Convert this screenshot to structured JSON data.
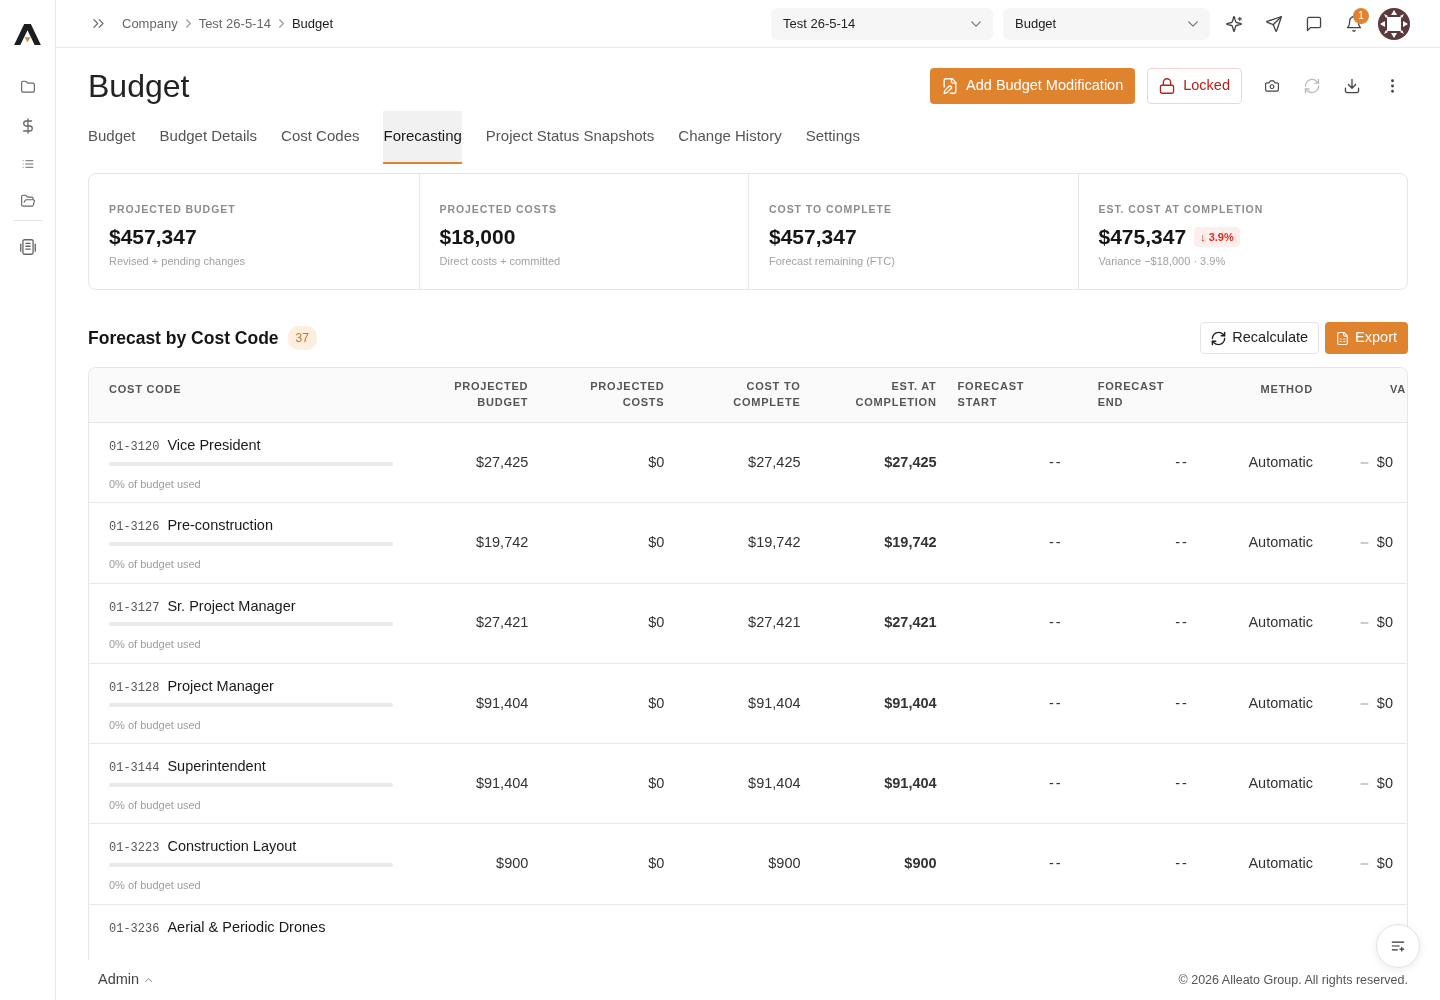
{
  "topbar": {
    "breadcrumbs": [
      {
        "label": "Company",
        "current": false
      },
      {
        "label": "Test 26-5-14",
        "current": false
      },
      {
        "label": "Budget",
        "current": true
      }
    ],
    "project_select": {
      "value": "Test 26-5-14"
    },
    "page_select": {
      "value": "Budget"
    },
    "notifications": {
      "count": "1"
    }
  },
  "page": {
    "title": "Budget",
    "actions": [
      {
        "label": "Add Budget Modification",
        "kind": "primary"
      },
      {
        "label": "Locked",
        "kind": "locked"
      }
    ],
    "toolbar": [
      {
        "disabled": false
      },
      {
        "disabled": true
      },
      {
        "disabled": false
      },
      {
        "disabled": false
      }
    ]
  },
  "tabs": [
    {
      "label": "Budget",
      "selected": false
    },
    {
      "label": "Budget Details",
      "selected": false
    },
    {
      "label": "Cost Codes",
      "selected": false
    },
    {
      "label": "Forecasting",
      "selected": true
    },
    {
      "label": "Project Status Snapshots",
      "selected": false
    },
    {
      "label": "Change History",
      "selected": false
    },
    {
      "label": "Settings",
      "selected": false
    }
  ],
  "summary": [
    {
      "label": "PROJECTED BUDGET",
      "value": "$457,347",
      "note": "Revised + pending changes"
    },
    {
      "label": "PROJECTED COSTS",
      "value": "$18,000",
      "note": "Direct costs + committed"
    },
    {
      "label": "COST TO COMPLETE",
      "value": "$457,347",
      "note": "Forecast remaining (FTC)"
    },
    {
      "label": "EST. COST AT COMPLETION",
      "value": "$475,347",
      "change": {
        "text": "↓ 3.9%",
        "negative": true
      },
      "note": "Variance −$18,000 · 3.9%"
    }
  ],
  "forecast": {
    "title": "Forecast by Cost Code",
    "count": "37",
    "actions": [
      {
        "label": "Recalculate",
        "kind": "secondary"
      },
      {
        "label": "Export",
        "kind": "primary"
      }
    ],
    "table": {
      "columns": [
        "COST CODE",
        "PROJECTED BUDGET",
        "PROJECTED COSTS",
        "COST TO COMPLETE",
        "EST. AT COMPLETION",
        "FORECAST START",
        "FORECAST END",
        "METHOD",
        "VA"
      ],
      "rows": [
        {
          "code": "01-3120",
          "name": "Vice President",
          "level": 0,
          "usage": "0% of budget used",
          "projected_budget": "$27,425",
          "projected_costs": "$0",
          "cost_to_complete": "$27,425",
          "est_at_completion": "$27,425",
          "forecast_start": "--",
          "forecast_end": "--",
          "method": "Automatic",
          "column_9": "$0"
        },
        {
          "code": "01-3126",
          "name": "Pre-construction",
          "level": 0,
          "usage": "0% of budget used",
          "projected_budget": "$19,742",
          "projected_costs": "$0",
          "cost_to_complete": "$19,742",
          "est_at_completion": "$19,742",
          "forecast_start": "--",
          "forecast_end": "--",
          "method": "Automatic",
          "column_9": "$0"
        },
        {
          "code": "01-3127",
          "name": "Sr. Project Manager",
          "level": 0,
          "usage": "0% of budget used",
          "projected_budget": "$27,421",
          "projected_costs": "$0",
          "cost_to_complete": "$27,421",
          "est_at_completion": "$27,421",
          "forecast_start": "--",
          "forecast_end": "--",
          "method": "Automatic",
          "column_9": "$0"
        },
        {
          "code": "01-3128",
          "name": "Project Manager",
          "level": 0,
          "usage": "0% of budget used",
          "projected_budget": "$91,404",
          "projected_costs": "$0",
          "cost_to_complete": "$91,404",
          "est_at_completion": "$91,404",
          "forecast_start": "--",
          "forecast_end": "--",
          "method": "Automatic",
          "column_9": "$0"
        },
        {
          "code": "01-3144",
          "name": "Superintendent",
          "level": 0,
          "usage": "0% of budget used",
          "projected_budget": "$91,404",
          "projected_costs": "$0",
          "cost_to_complete": "$91,404",
          "est_at_completion": "$91,404",
          "forecast_start": "--",
          "forecast_end": "--",
          "method": "Automatic",
          "column_9": "$0"
        },
        {
          "code": "01-3223",
          "name": "Construction Layout",
          "level": 0,
          "usage": "0% of budget used",
          "projected_budget": "$900",
          "projected_costs": "$0",
          "cost_to_complete": "$900",
          "est_at_completion": "$900",
          "forecast_start": "--",
          "forecast_end": "--",
          "method": "Automatic",
          "column_9": "$0"
        },
        {
          "code": "01-3236",
          "name": "Aerial & Periodic Drones"
        }
      ]
    }
  },
  "footer": {
    "user": "Admin",
    "copyright": "© 2026 Alleato Group. All rights reserved."
  }
}
